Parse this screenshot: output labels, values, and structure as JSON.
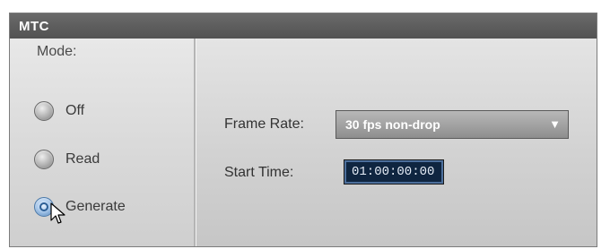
{
  "panel": {
    "title": "MTC"
  },
  "mode": {
    "label": "Mode:",
    "options": [
      {
        "label": "Off",
        "selected": false
      },
      {
        "label": "Read",
        "selected": false
      },
      {
        "label": "Generate",
        "selected": true
      }
    ]
  },
  "frame_rate": {
    "label": "Frame Rate:",
    "value": "30 fps non-drop",
    "arrow_icon": "dropdown-arrow-icon"
  },
  "start_time": {
    "label": "Start Time:",
    "value": "01:00:00:00"
  },
  "colors": {
    "title_bar": "#5a5a5a",
    "selected_radio": "#4a7fb8",
    "time_field_bg": "#0f2540"
  }
}
